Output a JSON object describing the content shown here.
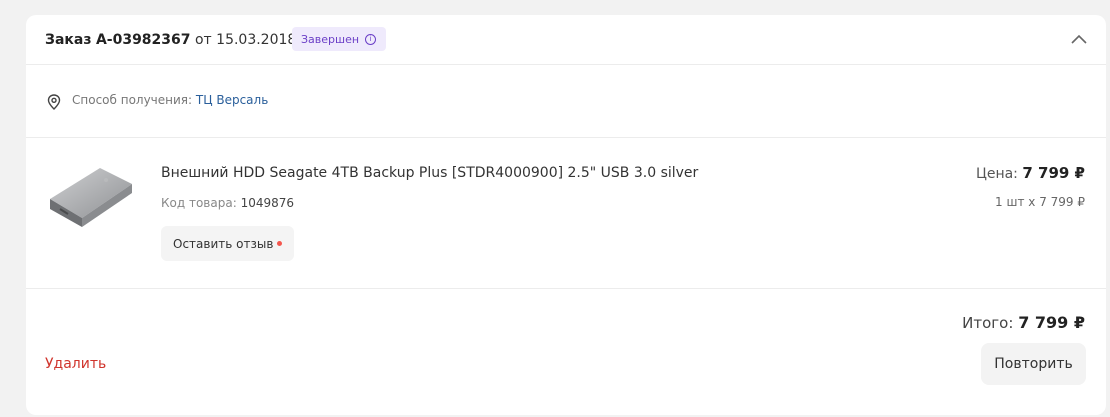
{
  "order": {
    "prefix": "Заказ",
    "number": "А-03982367",
    "date_prefix": "от",
    "date": "15.03.2018",
    "status": "Завершен",
    "status_icon_glyph": "i"
  },
  "delivery": {
    "label": "Способ получения:",
    "value": "ТЦ Версаль"
  },
  "product": {
    "name": "Внешний HDD Seagate 4TB Backup Plus [STDR4000900] 2.5\" USB 3.0 silver",
    "code_label": "Код товара:",
    "code_value": "1049876",
    "review_button": "Оставить отзыв",
    "price_label": "Цена:",
    "price_value": "7 799 ₽",
    "qty_line": "1 шт х 7 799 ₽"
  },
  "footer": {
    "total_label": "Итого:",
    "total_value": "7 799 ₽",
    "delete_label": "Удалить",
    "repeat_label": "Повторить"
  },
  "colors": {
    "status_bg": "#efeafc",
    "status_text": "#6b3fc7",
    "delete": "#d0342c",
    "link": "#2a5f9b",
    "review_dot": "#f4564d"
  }
}
